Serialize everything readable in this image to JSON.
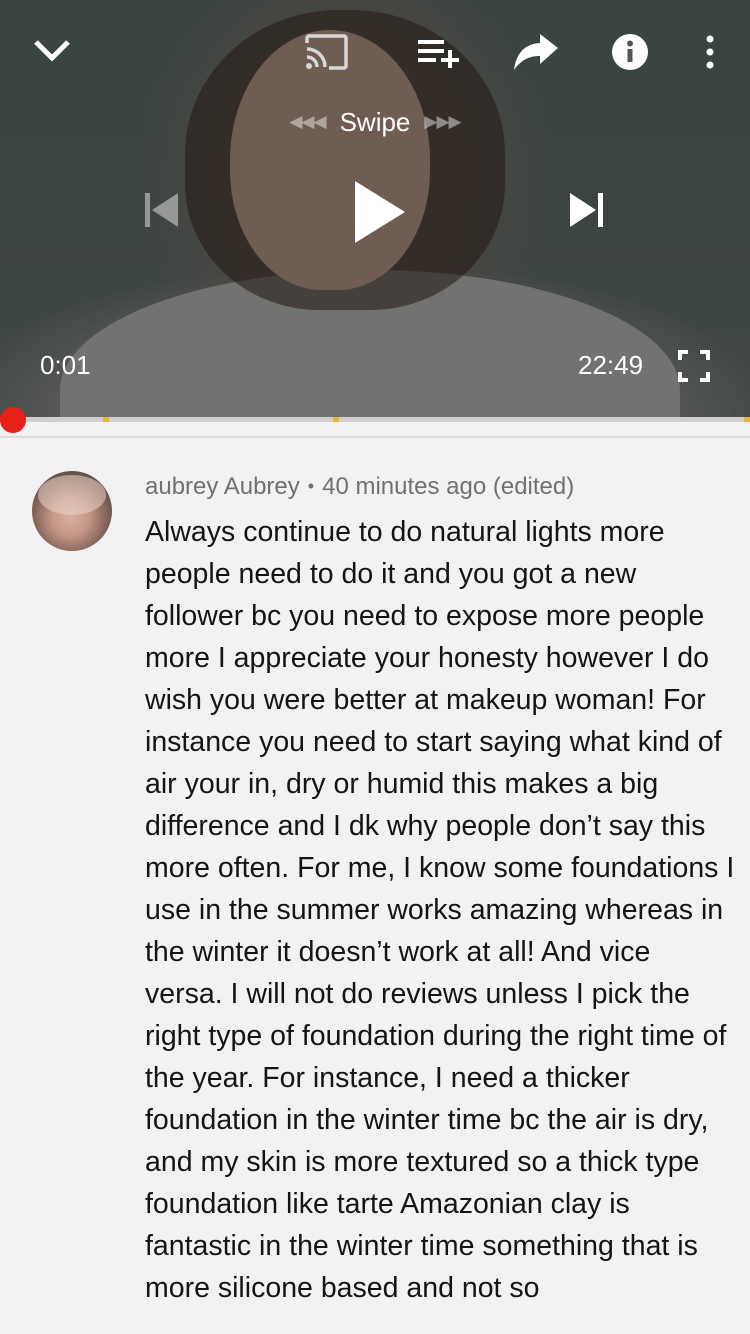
{
  "player": {
    "swipe_label": "Swipe",
    "current_time": "0:01",
    "duration": "22:49",
    "progress_fraction": 0.0007,
    "chapter_markers": [
      0.137,
      0.444,
      0.995
    ],
    "accent_color": "#e62117",
    "marker_color": "#e8b63a",
    "icons": [
      "chevron-down-icon",
      "cast-icon",
      "add-to-playlist-icon",
      "share-icon",
      "info-icon",
      "more-vert-icon",
      "skip-previous-icon",
      "play-icon",
      "skip-next-icon",
      "fullscreen-icon"
    ]
  },
  "comment": {
    "author": "aubrey Aubrey",
    "separator": "•",
    "timestamp": "40 minutes ago (edited)",
    "text": "Always continue to do natural lights more people need to do it and you got a new follower bc you need to expose more people more I appreciate your honesty however I do wish you were better at makeup woman! For instance you need to start saying what kind of air your in, dry or humid this makes a big difference and I dk why people don’t say this more often. For me, I know some foundations I use in the summer works amazing whereas in the winter it doesn’t work at all! And vice versa. I will not do reviews unless I pick the right type of foundation during the right time of the year. For instance, I need a thicker foundation in the winter time bc the air is dry, and my skin is more textured so a thick type foundation like tarte Amazonian clay is fantastic in the winter time something that is more silicone based and not so"
  }
}
